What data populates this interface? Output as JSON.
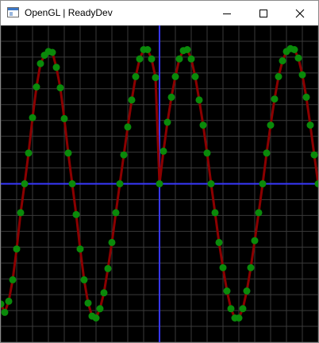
{
  "window": {
    "title": "OpenGL | ReadyDev",
    "controls": [
      "minimize-icon",
      "maximize-icon",
      "close-icon"
    ]
  },
  "chart_data": {
    "type": "line",
    "function": "sine",
    "x_range": [
      -2,
      2
    ],
    "y_range": [
      -1.7,
      1.7
    ],
    "grid": true,
    "background": "#000000",
    "colors": {
      "grid": "#3a3a3a",
      "axes": "#3838ff",
      "line": "#8b0000",
      "points": "#0a8a0a"
    },
    "series": [
      {
        "x": [
          -2.0,
          -1.95,
          -1.9,
          -1.85,
          -1.8,
          -1.75,
          -1.7,
          -1.65,
          -1.6,
          -1.55,
          -1.5,
          -1.45,
          -1.4,
          -1.35,
          -1.3,
          -1.25,
          -1.2,
          -1.15,
          -1.1,
          -1.05,
          -1.0,
          -0.95,
          -0.9,
          -0.85,
          -0.8,
          -0.75,
          -0.7,
          -0.65,
          -0.6,
          -0.55,
          -0.5,
          -0.45,
          -0.4,
          -0.35,
          -0.3,
          -0.25,
          -0.2,
          -0.15,
          -0.1,
          -0.05,
          0.0,
          0.05,
          0.1,
          0.15,
          0.2,
          0.25,
          0.3,
          0.35,
          0.4,
          0.45,
          0.5,
          0.55,
          0.6,
          0.65,
          0.7,
          0.75,
          0.8,
          0.85,
          0.9,
          0.95,
          1.0,
          1.05,
          1.1,
          1.15,
          1.2,
          1.25,
          1.3,
          1.35,
          1.4,
          1.45,
          1.5,
          1.55,
          1.6,
          1.65,
          1.7,
          1.75,
          1.8,
          1.85,
          1.9,
          1.95,
          2.0
        ],
        "y": [
          -1.29,
          -1.38,
          -1.26,
          -1.03,
          -0.7,
          -0.31,
          0.0,
          0.33,
          0.71,
          1.04,
          1.29,
          1.38,
          1.42,
          1.41,
          1.25,
          1.03,
          0.7,
          0.33,
          0.0,
          -0.33,
          -0.7,
          -1.03,
          -1.28,
          -1.42,
          -1.44,
          -1.34,
          -1.17,
          -0.91,
          -0.63,
          -0.31,
          0.0,
          0.31,
          0.61,
          0.9,
          1.15,
          1.34,
          1.44,
          1.44,
          1.34,
          1.14,
          0.0,
          0.35,
          0.66,
          0.93,
          1.15,
          1.34,
          1.43,
          1.44,
          1.34,
          1.15,
          0.9,
          0.63,
          0.33,
          0.0,
          -0.31,
          -0.63,
          -0.9,
          -1.15,
          -1.34,
          -1.44,
          -1.44,
          -1.34,
          -1.15,
          -0.9,
          -0.61,
          -0.31,
          0.0,
          0.33,
          0.63,
          0.91,
          1.15,
          1.32,
          1.42,
          1.45,
          1.44,
          1.35,
          1.17,
          0.93,
          0.63,
          0.31,
          0.0
        ]
      }
    ]
  }
}
